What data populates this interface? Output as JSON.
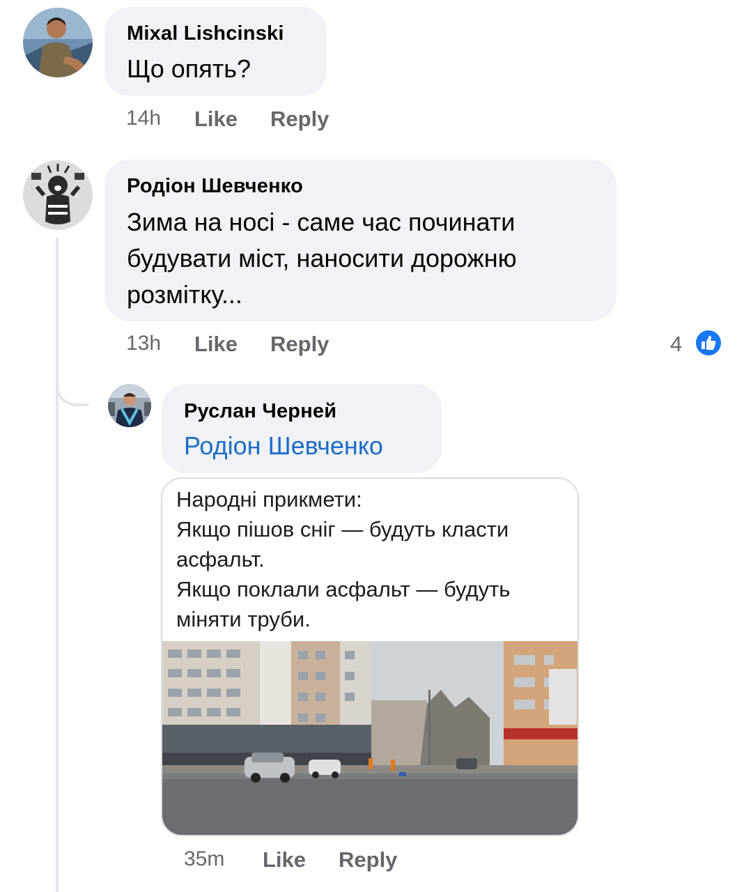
{
  "comments": [
    {
      "author": "Mixal Lishcinski",
      "text": "Що опять?",
      "time": "14h",
      "like_label": "Like",
      "reply_label": "Reply"
    },
    {
      "author": "Родіон Шевченко",
      "text": "Зима на носі - саме час починати\nбудувати міст, наносити дорожню\nрозмітку...",
      "time": "13h",
      "like_label": "Like",
      "reply_label": "Reply",
      "reaction_count": "4",
      "reaction_icon": "like-thumb-icon"
    }
  ],
  "reply": {
    "author": "Руслан Черней",
    "mention": "Родіон Шевченко",
    "attachment_text": "Народні прикмети:\nЯкщо пішов сніг — будуть класти\nасфальт.\nЯкщо поклали асфальт — будуть\nміняти труби.",
    "time": "35m",
    "like_label": "Like",
    "reply_label": "Reply"
  },
  "colors": {
    "bubble": "#f0f2f5",
    "mention": "#1b6cc7",
    "meta": "#65676b",
    "like_badge": "#1877f2"
  }
}
